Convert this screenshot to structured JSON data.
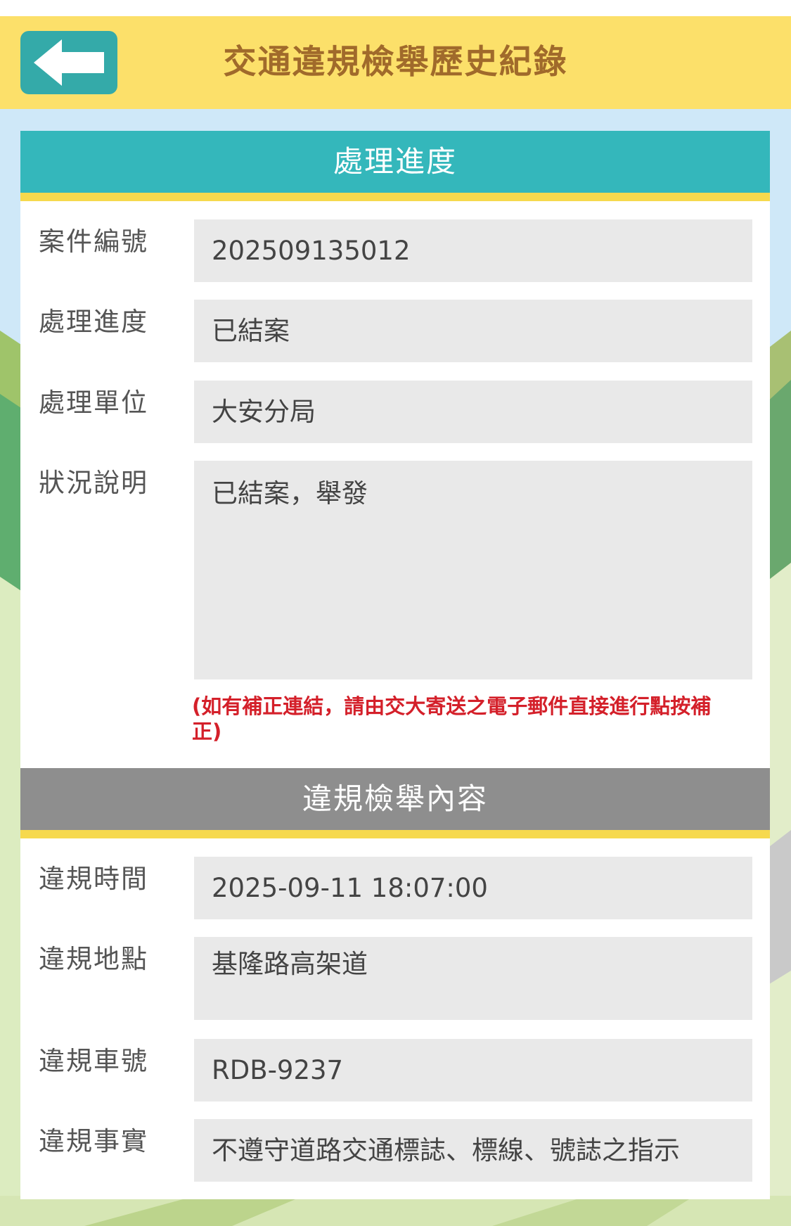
{
  "header": {
    "title": "交通違規檢舉歷史紀錄",
    "back_icon": "arrow-left-icon"
  },
  "progress_section": {
    "title": "處理進度",
    "rows": [
      {
        "label": "案件編號",
        "value": "202509135012"
      },
      {
        "label": "處理進度",
        "value": "已結案"
      },
      {
        "label": "處理單位",
        "value": "大安分局"
      },
      {
        "label": "狀況說明",
        "value": "已結案，舉發"
      }
    ],
    "note": "(如有補正連結，請由交大寄送之電子郵件直接進行點按補正)"
  },
  "content_section": {
    "title": "違規檢舉內容",
    "rows": [
      {
        "label": "違規時間",
        "value": "2025-09-11 18:07:00"
      },
      {
        "label": "違規地點",
        "value": "基隆路高架道"
      },
      {
        "label": "違規車號",
        "value": "RDB-9237"
      },
      {
        "label": "違規事實",
        "value": "不遵守道路交通標誌、標線、號誌之指示"
      }
    ]
  },
  "colors": {
    "header_bg": "#fce06a",
    "header_title": "#a06a2b",
    "back_button": "#34aaa9",
    "section_teal": "#34b7bb",
    "section_gray": "#8e8e8e",
    "stripe": "#f6d94e",
    "note_red": "#d4202a"
  }
}
